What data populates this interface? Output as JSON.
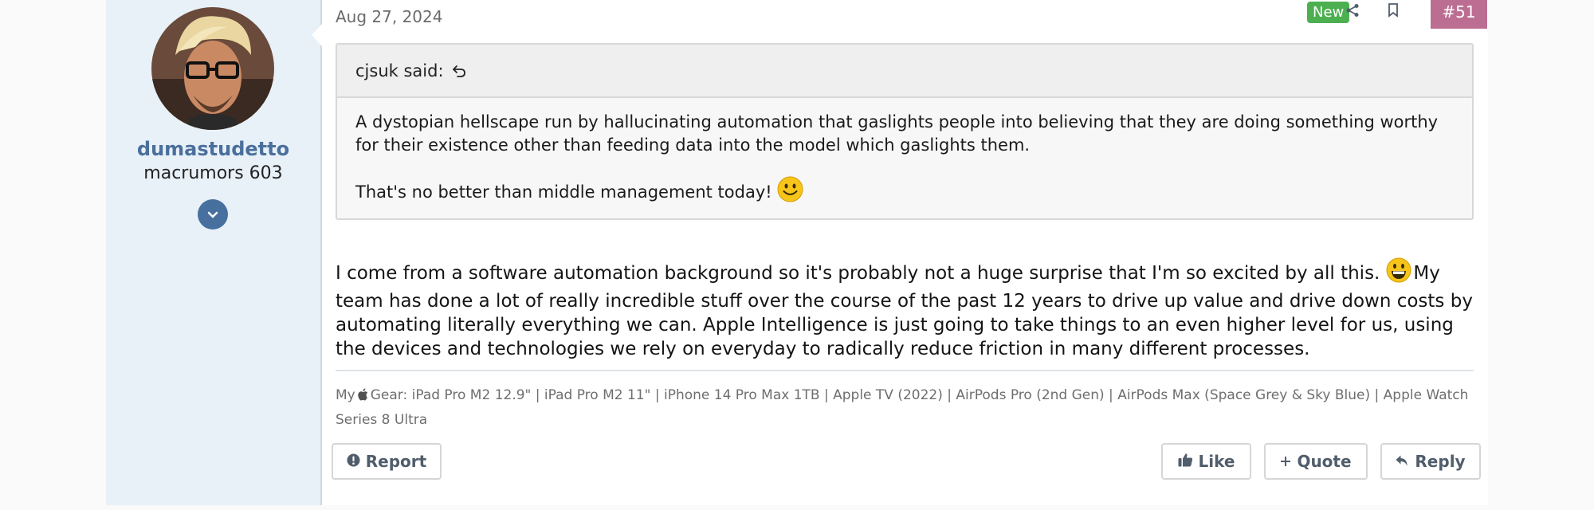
{
  "post": {
    "date": "Aug 27, 2024",
    "new_badge": "New",
    "post_number": "#51",
    "icons": {
      "share": "share-icon",
      "bookmark": "bookmark-icon"
    }
  },
  "user": {
    "name": "dumastudetto",
    "title": "macrumors 603"
  },
  "quote": {
    "author": "cjsuk said:",
    "paragraph1": "A dystopian hellscape run by hallucinating automation that gaslights people into believing that they are doing something worthy for their existence other than feeding data into the model which gaslights them.",
    "paragraph2": "That's no better than middle management today!"
  },
  "body": {
    "part1": "I come from a software automation background so it's probably not a huge surprise that I'm so excited by all this.",
    "part2": "My team has done a lot of really incredible stuff over the course of the past 12 years to drive up value and drive down costs by automating literally everything we can. Apple Intelligence is just going to take things to an even higher level for us, using the devices and technologies we rely on everyday to radically reduce friction in many different processes."
  },
  "signature": {
    "prefix": "My",
    "text": "Gear: iPad Pro M2 12.9\" | iPad Pro M2 11\" | iPhone 14 Pro Max 1TB | Apple TV (2022) | AirPods Pro (2nd Gen) | AirPods Max (Space Grey & Sky Blue) | Apple Watch Series 8 Ultra"
  },
  "actions": {
    "report": "Report",
    "like": "Like",
    "quote": "Quote",
    "reply": "Reply"
  },
  "colors": {
    "username": "#4a6f9c",
    "badge_new": "#4caf50",
    "post_number_bg": "#bc6d92",
    "user_column_bg": "#e8f0f8"
  }
}
